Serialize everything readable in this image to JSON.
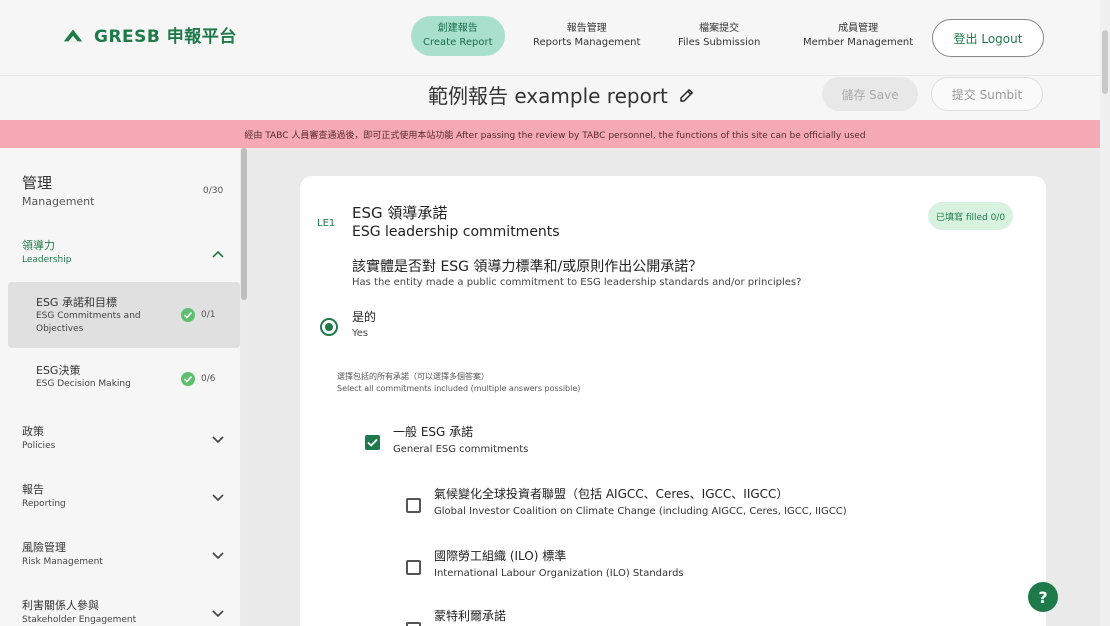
{
  "brand": {
    "name": "GRESB 申報平台",
    "icon": "mountain-logo-icon",
    "color": "#1f7a4b"
  },
  "nav": [
    {
      "zh": "創建報告",
      "en": "Create Report",
      "active": true
    },
    {
      "zh": "報告管理",
      "en": "Reports Management"
    },
    {
      "zh": "檔案提交",
      "en": "Files Submission"
    },
    {
      "zh": "成員管理",
      "en": "Member Management"
    }
  ],
  "logout_label": "登出 Logout",
  "report": {
    "title": "範例報告 example report",
    "save_label": "儲存 Save",
    "submit_label": "提交 Sumbit"
  },
  "notice": "經由 TABC 人員審查通過後，即可正式使用本站功能   After passing the review by TABC personnel, the functions of this site can be officially used",
  "sidebar": {
    "section": {
      "zh": "管理",
      "en": "Management",
      "count": "0/30"
    },
    "groups": [
      {
        "zh": "領導力",
        "en": "Leadership",
        "expanded": true,
        "items": [
          {
            "zh": "ESG 承諾和目標",
            "en": "ESG Commitments and Objectives",
            "count": "0/1",
            "active": true
          },
          {
            "zh": "ESG決策",
            "en": "ESG Decision Making",
            "count": "0/6"
          }
        ]
      },
      {
        "zh": "政策",
        "en": "Policies"
      },
      {
        "zh": "報告",
        "en": "Reporting"
      },
      {
        "zh": "風險管理",
        "en": "Risk Management"
      },
      {
        "zh": "利害關係人參與",
        "en": "Stakeholder Engagement"
      }
    ]
  },
  "question": {
    "id": "LE1",
    "title_zh": "ESG 領導承諾",
    "title_en": "ESG leadership commitments",
    "filled": "已填寫 filled 0/0",
    "text_zh": "該實體是否對 ESG 領導力標準和/或原則作出公開承諾？",
    "text_en": "Has the entity made a public commitment to ESG leadership standards and/or principles?",
    "answer": {
      "zh": "是的",
      "en": "Yes",
      "selected": true
    },
    "instruction_zh": "選擇包括的所有承諾（可以選擇多個答案）",
    "instruction_en": "Select all commitments included (multiple answers possible)",
    "options": [
      {
        "zh": "一般 ESG 承諾",
        "en": "General ESG commitments",
        "checked": true
      },
      {
        "zh": "氣候變化全球投資者聯盟（包括 AIGCC、Ceres、IGCC、IIGCC）",
        "en": "Global Investor Coalition on Climate Change (including AIGCC, Ceres, IGCC, IIGCC)",
        "checked": false
      },
      {
        "zh": "國際勞工組織 (ILO) 標準",
        "en": "International Labour Organization (ILO) Standards",
        "checked": false
      },
      {
        "zh": "蒙特利爾承諾",
        "en": "",
        "checked": false
      }
    ]
  },
  "help_icon": "question-help-icon"
}
